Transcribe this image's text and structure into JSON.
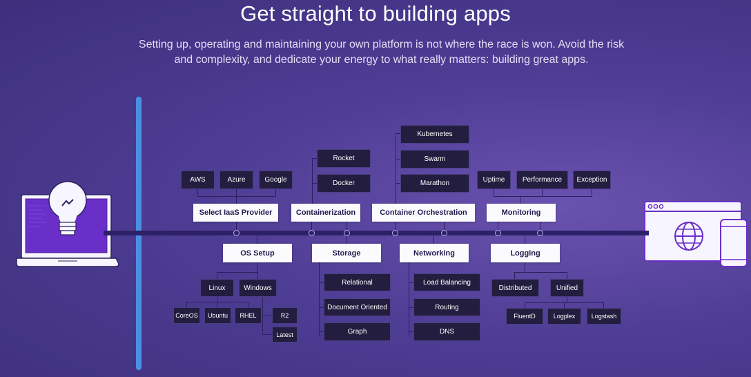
{
  "header": {
    "title": "Get straight to building apps",
    "subtitle": "Setting up, operating and maintaining your own platform is not where the race is won. Avoid the risk and complexity, and dedicate your energy to what really matters: building great apps."
  },
  "diagram": {
    "top_categories": {
      "iaas": "Select IaaS Provider",
      "containerization": "Containerization",
      "orchestration": "Container Orchestration",
      "monitoring": "Monitoring"
    },
    "bottom_categories": {
      "os_setup": "OS Setup",
      "storage": "Storage",
      "networking": "Networking",
      "logging": "Logging"
    },
    "iaas_options": [
      "AWS",
      "Azure",
      "Google"
    ],
    "containerization_options": [
      "Rocket",
      "Docker"
    ],
    "orchestration_options": [
      "Kubernetes",
      "Swarm",
      "Marathon"
    ],
    "monitoring_options": [
      "Uptime",
      "Performance",
      "Exception"
    ],
    "os_options": [
      "Linux",
      "Windows"
    ],
    "linux_distros": [
      "CoreOS",
      "Ubuntu",
      "RHEL"
    ],
    "windows_versions": [
      "R2",
      "Latest"
    ],
    "storage_options": [
      "Relational",
      "Document Oriented",
      "Graph"
    ],
    "networking_options": [
      "Load Balancing",
      "Routing",
      "DNS"
    ],
    "logging_options": [
      "Distributed",
      "Unified"
    ],
    "log_tools": [
      "FluentD",
      "Logplex",
      "Logstash"
    ]
  },
  "colors": {
    "background": "#4e3d94",
    "accent_bar": "#4a90e2",
    "timeline": "#2c2166",
    "dark_box": "#231d3f",
    "screen": "#6a2fc8"
  }
}
